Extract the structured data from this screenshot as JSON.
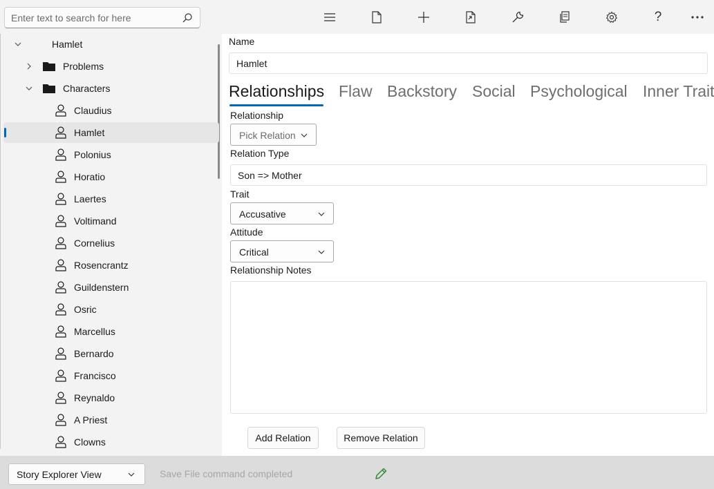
{
  "search": {
    "placeholder": "Enter text to search for here",
    "icon": "search-icon"
  },
  "toolbar": {
    "buttons": [
      {
        "name": "menu-button",
        "icon": "hamburger-icon"
      },
      {
        "name": "new-file-button",
        "icon": "document-icon"
      },
      {
        "name": "add-button",
        "icon": "plus-icon"
      },
      {
        "name": "move-button",
        "icon": "move-document-icon"
      },
      {
        "name": "tools-button",
        "icon": "wrench-icon"
      },
      {
        "name": "copy-button",
        "icon": "copy-icon"
      },
      {
        "name": "settings-button",
        "icon": "gear-icon"
      },
      {
        "name": "help-button",
        "icon": "question-icon"
      },
      {
        "name": "more-button",
        "icon": "ellipsis-icon"
      }
    ]
  },
  "tree": {
    "root": {
      "label": "Hamlet",
      "expanded": true
    },
    "folders": [
      {
        "label": "Problems",
        "expanded": false,
        "icon": "folder-icon"
      },
      {
        "label": "Characters",
        "expanded": true,
        "icon": "folder-icon"
      }
    ],
    "characters": [
      "Claudius",
      "Hamlet",
      "Polonius",
      "Horatio",
      "Laertes",
      "Voltimand",
      "Cornelius",
      "Rosencrantz",
      "Guildenstern",
      "Osric",
      "Marcellus",
      "Bernardo",
      "Francisco",
      "Reynaldo",
      "A Priest",
      "Clowns"
    ],
    "selected": "Hamlet",
    "character_icon": "person-icon"
  },
  "form": {
    "name_label": "Name",
    "name_value": "Hamlet",
    "tabs": [
      "Relationships",
      "Flaw",
      "Backstory",
      "Social",
      "Psychological",
      "Inner Trait"
    ],
    "active_tab": "Relationships",
    "relationship_label": "Relationship",
    "relationship_placeholder": "Pick Relation",
    "relation_type_label": "Relation Type",
    "relation_type_value": "Son => Mother",
    "trait_label": "Trait",
    "trait_value": "Accusative",
    "attitude_label": "Attitude",
    "attitude_value": "Critical",
    "notes_label": "Relationship Notes",
    "notes_value": "",
    "add_button": "Add Relation",
    "remove_button": "Remove Relation"
  },
  "statusbar": {
    "view_selector": "Story Explorer View",
    "message": "Save File command completed",
    "edit_icon": "pencil-icon",
    "edit_color": "#2e8b2e"
  },
  "colors": {
    "accent": "#0067c0"
  }
}
